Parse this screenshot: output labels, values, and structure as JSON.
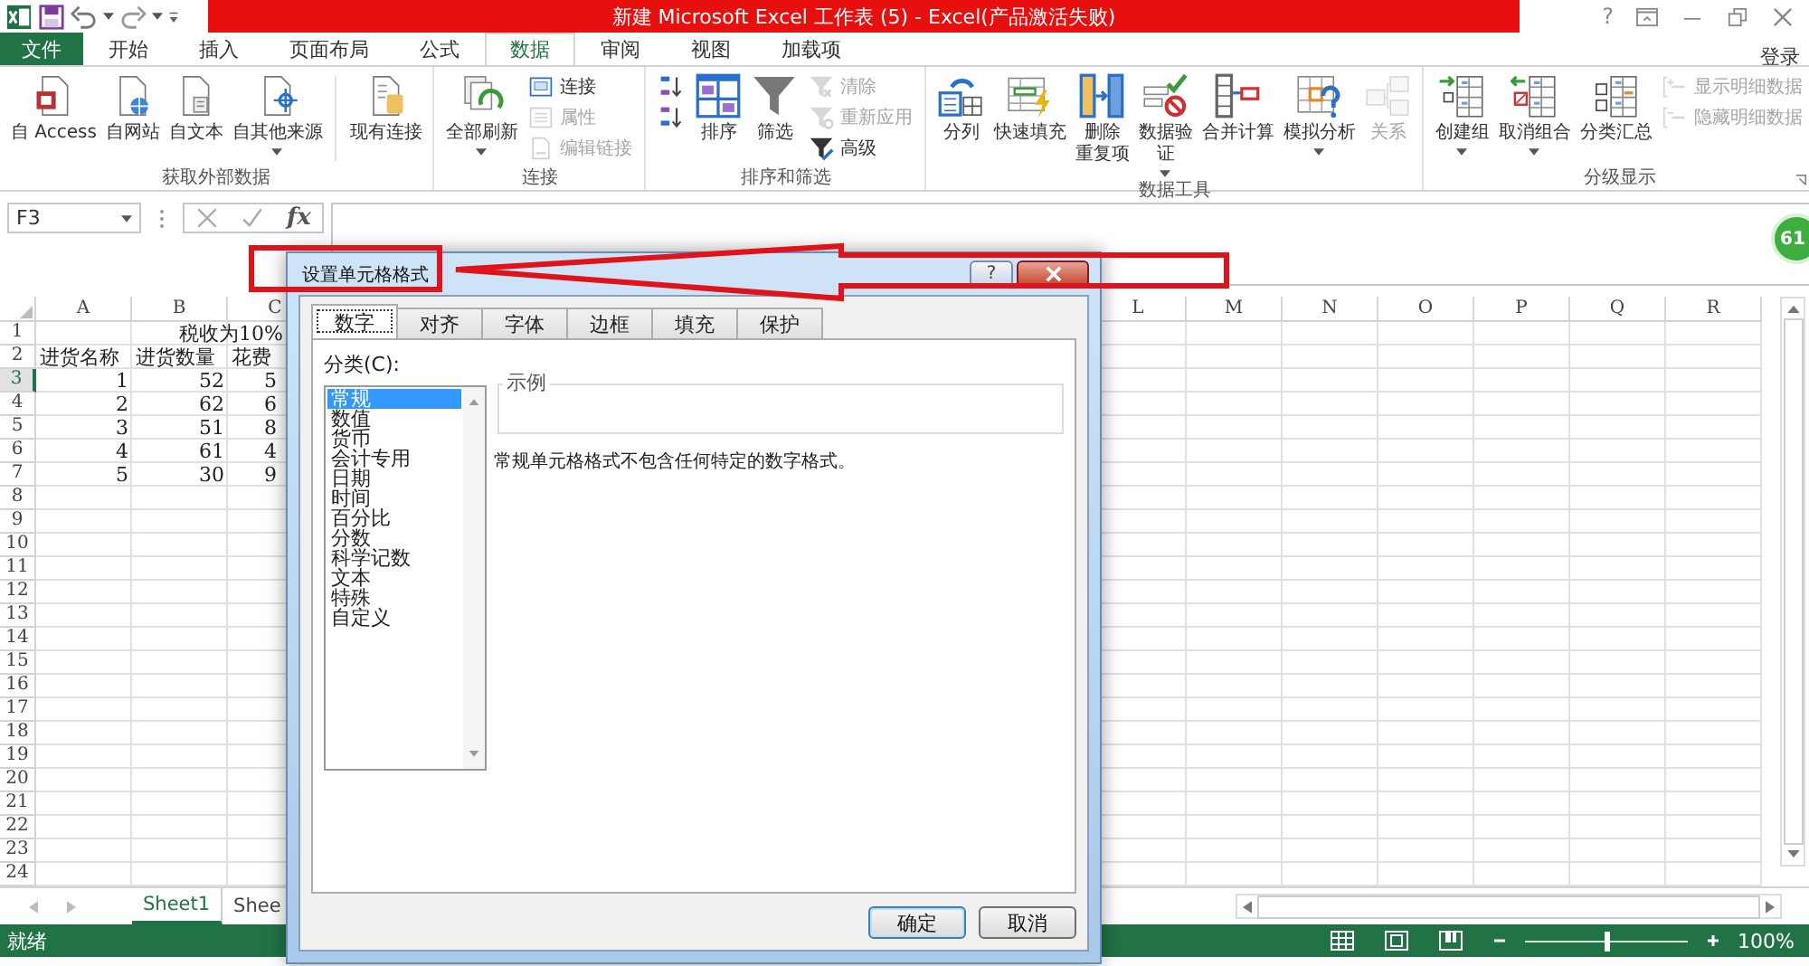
{
  "title_bar": {
    "title": "新建 Microsoft Excel 工作表 (5) -  Excel(产品激活失败)",
    "help": "?"
  },
  "ribbon_tabs": [
    {
      "label": "文件",
      "kind": "file",
      "selected": false
    },
    {
      "label": "开始",
      "kind": "tab",
      "selected": false
    },
    {
      "label": "插入",
      "kind": "tab",
      "selected": false
    },
    {
      "label": "页面布局",
      "kind": "tab",
      "selected": false
    },
    {
      "label": "公式",
      "kind": "tab",
      "selected": false
    },
    {
      "label": "数据",
      "kind": "tab",
      "selected": true
    },
    {
      "label": "审阅",
      "kind": "tab",
      "selected": false
    },
    {
      "label": "视图",
      "kind": "tab",
      "selected": false
    },
    {
      "label": "加载项",
      "kind": "tab",
      "selected": false
    }
  ],
  "account": "登录",
  "ribbon_groups": [
    {
      "label": "获取外部数据",
      "buttons": [
        {
          "label": "自 Access",
          "kind": "large",
          "disabled": false,
          "dropdown": false
        },
        {
          "label": "自网站",
          "kind": "large",
          "disabled": false,
          "dropdown": false
        },
        {
          "label": "自文本",
          "kind": "large",
          "disabled": false,
          "dropdown": false
        },
        {
          "label": "自其他来源",
          "kind": "large",
          "disabled": false,
          "dropdown": true
        },
        {
          "kind": "separator"
        },
        {
          "label": "现有连接",
          "kind": "large",
          "disabled": false,
          "dropdown": false
        }
      ]
    },
    {
      "label": "连接",
      "buttons": [
        {
          "label": "全部刷新",
          "kind": "large",
          "disabled": false,
          "dropdown": true
        },
        {
          "label": "连接",
          "kind": "small",
          "disabled": false
        },
        {
          "label": "属性",
          "kind": "small",
          "disabled": true
        },
        {
          "label": "编辑链接",
          "kind": "small",
          "disabled": true
        }
      ]
    },
    {
      "label": "排序和筛选",
      "buttons": [
        {
          "kind": "small",
          "disabled": false
        },
        {
          "kind": "small",
          "disabled": false
        },
        {
          "label": "排序",
          "kind": "large",
          "disabled": false,
          "dropdown": false
        },
        {
          "label": "筛选",
          "kind": "large",
          "disabled": false,
          "dropdown": false
        },
        {
          "label": "清除",
          "kind": "small",
          "disabled": true
        },
        {
          "label": "重新应用",
          "kind": "small",
          "disabled": true
        },
        {
          "label": "高级",
          "kind": "small",
          "disabled": false
        }
      ]
    },
    {
      "label": "数据工具",
      "buttons": [
        {
          "label": "分列",
          "kind": "large",
          "disabled": false,
          "dropdown": false
        },
        {
          "label": "快速填充",
          "kind": "large",
          "disabled": false,
          "dropdown": false
        },
        {
          "label_lines": [
            "删除",
            "重复项"
          ],
          "kind": "large",
          "disabled": false,
          "dropdown": false
        },
        {
          "label_lines": [
            "数据验",
            "证"
          ],
          "kind": "large",
          "disabled": false,
          "dropdown": true
        },
        {
          "label": "合并计算",
          "kind": "large",
          "disabled": false,
          "dropdown": false
        },
        {
          "label": "模拟分析",
          "kind": "large",
          "disabled": false,
          "dropdown": true
        },
        {
          "label": "关系",
          "kind": "large",
          "disabled": true,
          "dropdown": false
        }
      ]
    },
    {
      "label": "分级显示",
      "launcher": true,
      "buttons": [
        {
          "label": "创建组",
          "kind": "large",
          "disabled": false,
          "dropdown": true
        },
        {
          "label": "取消组合",
          "kind": "large",
          "disabled": false,
          "dropdown": true
        },
        {
          "label": "分类汇总",
          "kind": "large",
          "disabled": false,
          "dropdown": false
        },
        {
          "label": "显示明细数据",
          "kind": "small",
          "disabled": true
        },
        {
          "label": "隐藏明细数据",
          "kind": "small",
          "disabled": true
        }
      ]
    }
  ],
  "formula_bar": {
    "name_box": "F3",
    "function_button": "fx"
  },
  "float_badge": "61",
  "sheet": {
    "columns": [
      "A",
      "B",
      "C",
      "L",
      "M",
      "N",
      "O",
      "P",
      "Q",
      "R"
    ],
    "rows": [
      {
        "header": "1",
        "selected": false,
        "kind": "title",
        "cells": [
          "",
          "税收为10%"
        ]
      },
      {
        "header": "2",
        "selected": false,
        "kind": "header",
        "cells": [
          "进货名称",
          "进货数量",
          "花费"
        ]
      },
      {
        "header": "3",
        "selected": true,
        "kind": "data",
        "cells": [
          "1",
          "52",
          "5"
        ]
      },
      {
        "header": "4",
        "selected": false,
        "kind": "data",
        "cells": [
          "2",
          "62",
          "6"
        ]
      },
      {
        "header": "5",
        "selected": false,
        "kind": "data",
        "cells": [
          "3",
          "51",
          "8"
        ]
      },
      {
        "header": "6",
        "selected": false,
        "kind": "data",
        "cells": [
          "4",
          "61",
          "4"
        ]
      },
      {
        "header": "7",
        "selected": false,
        "kind": "data",
        "cells": [
          "5",
          "30",
          "9"
        ]
      },
      {
        "header": "8",
        "selected": false,
        "cells": []
      },
      {
        "header": "9",
        "selected": false,
        "cells": []
      },
      {
        "header": "10",
        "selected": false,
        "cells": []
      },
      {
        "header": "11",
        "selected": false,
        "cells": []
      },
      {
        "header": "12",
        "selected": false,
        "cells": []
      },
      {
        "header": "13",
        "selected": false,
        "cells": []
      },
      {
        "header": "14",
        "selected": false,
        "cells": []
      },
      {
        "header": "15",
        "selected": false,
        "cells": []
      },
      {
        "header": "16",
        "selected": false,
        "cells": []
      },
      {
        "header": "17",
        "selected": false,
        "cells": []
      },
      {
        "header": "18",
        "selected": false,
        "cells": []
      },
      {
        "header": "19",
        "selected": false,
        "cells": []
      },
      {
        "header": "20",
        "selected": false,
        "cells": []
      },
      {
        "header": "21",
        "selected": false,
        "cells": []
      },
      {
        "header": "22",
        "selected": false,
        "cells": []
      },
      {
        "header": "23",
        "selected": false,
        "cells": []
      },
      {
        "header": "24",
        "selected": false,
        "cells": []
      }
    ]
  },
  "sheet_tabs": [
    {
      "label": "Sheet1",
      "selected": true
    },
    {
      "label": "Shee",
      "selected": false
    }
  ],
  "status_bar": {
    "text": "就绪",
    "zoom_slider": {
      "level": 0.5
    },
    "zoom": "100%"
  },
  "dialog": {
    "title": "设置单元格格式",
    "help": "?",
    "tabs": [
      {
        "label": "数字",
        "selected": true
      },
      {
        "label": "对齐",
        "selected": false
      },
      {
        "label": "字体",
        "selected": false
      },
      {
        "label": "边框",
        "selected": false
      },
      {
        "label": "填充",
        "selected": false
      },
      {
        "label": "保护",
        "selected": false
      }
    ],
    "category_label": "分类(C):",
    "categories": [
      {
        "label": "常规",
        "selected": true
      },
      {
        "label": "数值",
        "selected": false
      },
      {
        "label": "货币",
        "selected": false
      },
      {
        "label": "会计专用",
        "selected": false
      },
      {
        "label": "日期",
        "selected": false
      },
      {
        "label": "时间",
        "selected": false
      },
      {
        "label": "百分比",
        "selected": false
      },
      {
        "label": "分数",
        "selected": false
      },
      {
        "label": "科学记数",
        "selected": false
      },
      {
        "label": "文本",
        "selected": false
      },
      {
        "label": "特殊",
        "selected": false
      },
      {
        "label": "自定义",
        "selected": false
      }
    ],
    "sample_label": "示例",
    "description": "常规单元格格式不包含任何特定的数字格式。",
    "buttons": [
      {
        "label": "确定",
        "kind": "default"
      },
      {
        "label": "取消",
        "kind": "normal"
      }
    ]
  }
}
